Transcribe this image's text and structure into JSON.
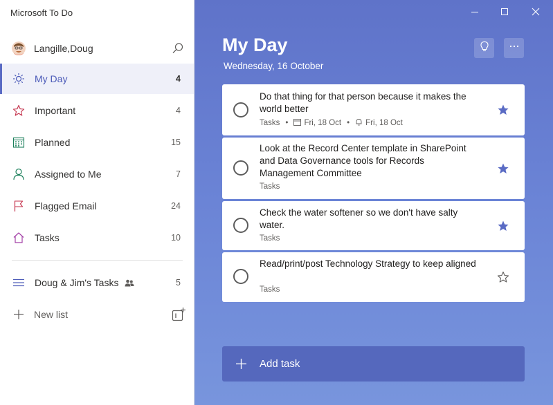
{
  "app": {
    "title": "Microsoft To Do"
  },
  "user": {
    "name": "Langille,Doug"
  },
  "sidebar": {
    "items": [
      {
        "label": "My Day",
        "count": "4",
        "icon": "sun-icon"
      },
      {
        "label": "Important",
        "count": "4",
        "icon": "star-icon"
      },
      {
        "label": "Planned",
        "count": "15",
        "icon": "calendar-icon"
      },
      {
        "label": "Assigned to Me",
        "count": "7",
        "icon": "person-icon"
      },
      {
        "label": "Flagged Email",
        "count": "24",
        "icon": "flag-icon"
      },
      {
        "label": "Tasks",
        "count": "10",
        "icon": "home-icon"
      }
    ],
    "lists": [
      {
        "label": "Doug & Jim's Tasks",
        "count": "5",
        "shared": true
      }
    ],
    "new_list_label": "New list"
  },
  "main": {
    "title": "My Day",
    "date": "Wednesday, 16 October",
    "tasks": [
      {
        "title": "Do that thing for that person because it makes the world better",
        "list": "Tasks",
        "due": "Fri, 18 Oct",
        "reminder": "Fri, 18 Oct",
        "important": true
      },
      {
        "title": "Look at the Record Center template in SharePoint and Data Governance tools for Records Management Committee",
        "list": "Tasks",
        "important": true
      },
      {
        "title": "Check the water softener so we don't have salty water.",
        "list": "Tasks",
        "important": true
      },
      {
        "title": "Read/print/post Technology Strategy to keep aligned",
        "list": "Tasks",
        "important": false
      }
    ],
    "add_task_label": "Add task"
  },
  "colors": {
    "accent": "#5a6bc4",
    "main_bg_top": "#5f73c9",
    "main_bg_bottom": "#7895dd",
    "add_task_bg": "#5568bd",
    "star": "#5a6bc4"
  }
}
